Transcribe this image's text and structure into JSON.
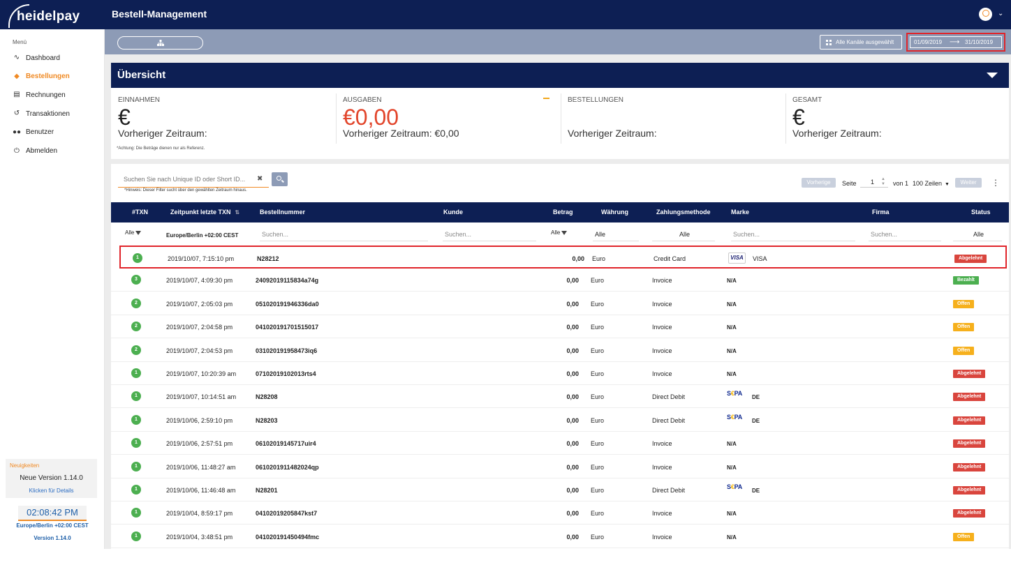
{
  "header": {
    "logo_text": "heidelpay",
    "title": "Bestell-Management"
  },
  "sidebar": {
    "menu_label": "Menü",
    "items": [
      {
        "label": "Dashboard",
        "icon": "chart-line-icon",
        "active": false
      },
      {
        "label": "Bestellungen",
        "icon": "tags-icon",
        "active": true
      },
      {
        "label": "Rechnungen",
        "icon": "document-icon",
        "active": false
      },
      {
        "label": "Transaktionen",
        "icon": "history-icon",
        "active": false
      },
      {
        "label": "Benutzer",
        "icon": "users-icon",
        "active": false
      },
      {
        "label": "Abmelden",
        "icon": "power-icon",
        "active": false
      }
    ],
    "news": {
      "title": "Neuigkeiten",
      "version_text": "Neue Version 1.14.0",
      "link": "Klicken für Details"
    },
    "clock": "02:08:42 PM",
    "timezone": "Europe/Berlin +02:00 CEST",
    "version": "Version 1.14.0"
  },
  "filterbar": {
    "channels_label": "Alle Kanäle ausgewählt",
    "date_from": "01/09/2019",
    "date_to": "31/10/2019"
  },
  "overview": {
    "title": "Übersicht",
    "kpis": [
      {
        "label": "EINNAHMEN",
        "value": "€",
        "prev": "Vorheriger Zeitraum:"
      },
      {
        "label": "AUSGABEN",
        "value": "€0,00",
        "prev": "Vorheriger Zeitraum: €0,00"
      },
      {
        "label": "BESTELLUNGEN",
        "value": "",
        "prev": "Vorheriger Zeitraum:"
      },
      {
        "label": "GESAMT",
        "value": "€",
        "prev": "Vorheriger Zeitraum:"
      }
    ],
    "note": "*Achtung: Die Beträge dienen nur als Referenz."
  },
  "table_controls": {
    "search_placeholder": "Suchen Sie nach Unique ID oder Short ID...",
    "search_hint": "*Hinweis: Dieser Filter sucht über den gewählten Zeitraum hinaus.",
    "prev_label": "Vorherige",
    "page_label": "Seite",
    "page_value": "1",
    "of_label": "von 1",
    "rows_label": "100 Zeilen",
    "next_label": "Weiter"
  },
  "table": {
    "columns": [
      "#TXN",
      "Zeitpunkt letzte TXN",
      "Bestellnummer",
      "Kunde",
      "Betrag",
      "Währung",
      "Zahlungsmethode",
      "Marke",
      "Firma",
      "Status"
    ],
    "filters": {
      "txn": "Alle",
      "timezone": "Europe/Berlin +02:00 CEST",
      "search": "Suchen...",
      "betrag": "Alle",
      "waehrung": "Alle",
      "zahlungsmethode": "Alle",
      "status": "Alle"
    },
    "rows": [
      {
        "txn": "1",
        "time": "2019/10/07, 7:15:10 pm",
        "order": "N28212",
        "amount": "0,00",
        "currency": "Euro",
        "method": "Credit Card",
        "brand_logo": "visa",
        "brand": "VISA",
        "status": "Abgelehnt",
        "status_color": "red"
      },
      {
        "txn": "3",
        "time": "2019/10/07, 4:09:30 pm",
        "order": "24092019115834a74g",
        "amount": "0,00",
        "currency": "Euro",
        "method": "Invoice",
        "brand_logo": "",
        "brand": "N/A",
        "status": "Bezahlt",
        "status_color": "green"
      },
      {
        "txn": "2",
        "time": "2019/10/07, 2:05:03 pm",
        "order": "051020191946336da0",
        "amount": "0,00",
        "currency": "Euro",
        "method": "Invoice",
        "brand_logo": "",
        "brand": "N/A",
        "status": "Offen",
        "status_color": "orange"
      },
      {
        "txn": "2",
        "time": "2019/10/07, 2:04:58 pm",
        "order": "041020191701515017",
        "amount": "0,00",
        "currency": "Euro",
        "method": "Invoice",
        "brand_logo": "",
        "brand": "N/A",
        "status": "Offen",
        "status_color": "orange"
      },
      {
        "txn": "2",
        "time": "2019/10/07, 2:04:53 pm",
        "order": "031020191958473iq6",
        "amount": "0,00",
        "currency": "Euro",
        "method": "Invoice",
        "brand_logo": "",
        "brand": "N/A",
        "status": "Offen",
        "status_color": "orange"
      },
      {
        "txn": "1",
        "time": "2019/10/07, 10:20:39 am",
        "order": "07102019102013rts4",
        "amount": "0,00",
        "currency": "Euro",
        "method": "Invoice",
        "brand_logo": "",
        "brand": "N/A",
        "status": "Abgelehnt",
        "status_color": "red"
      },
      {
        "txn": "1",
        "time": "2019/10/07, 10:14:51 am",
        "order": "N28208",
        "amount": "0,00",
        "currency": "Euro",
        "method": "Direct Debit",
        "brand_logo": "sepa",
        "brand": "DE",
        "status": "Abgelehnt",
        "status_color": "red"
      },
      {
        "txn": "1",
        "time": "2019/10/06, 2:59:10 pm",
        "order": "N28203",
        "amount": "0,00",
        "currency": "Euro",
        "method": "Direct Debit",
        "brand_logo": "sepa",
        "brand": "DE",
        "status": "Abgelehnt",
        "status_color": "red"
      },
      {
        "txn": "1",
        "time": "2019/10/06, 2:57:51 pm",
        "order": "06102019145717uir4",
        "amount": "0,00",
        "currency": "Euro",
        "method": "Invoice",
        "brand_logo": "",
        "brand": "N/A",
        "status": "Abgelehnt",
        "status_color": "red"
      },
      {
        "txn": "1",
        "time": "2019/10/06, 11:48:27 am",
        "order": "0610201911482024qp",
        "amount": "0,00",
        "currency": "Euro",
        "method": "Invoice",
        "brand_logo": "",
        "brand": "N/A",
        "status": "Abgelehnt",
        "status_color": "red"
      },
      {
        "txn": "1",
        "time": "2019/10/06, 11:46:48 am",
        "order": "N28201",
        "amount": "0,00",
        "currency": "Euro",
        "method": "Direct Debit",
        "brand_logo": "sepa",
        "brand": "DE",
        "status": "Abgelehnt",
        "status_color": "red"
      },
      {
        "txn": "1",
        "time": "2019/10/04, 8:59:17 pm",
        "order": "04102019205847kst7",
        "amount": "0,00",
        "currency": "Euro",
        "method": "Invoice",
        "brand_logo": "",
        "brand": "N/A",
        "status": "Abgelehnt",
        "status_color": "red"
      },
      {
        "txn": "1",
        "time": "2019/10/04, 3:48:51 pm",
        "order": "041020191450494fmc",
        "amount": "0,00",
        "currency": "Euro",
        "method": "Invoice",
        "brand_logo": "",
        "brand": "N/A",
        "status": "Offen",
        "status_color": "orange"
      }
    ]
  },
  "colors": {
    "navy": "#0d1f54",
    "accent_orange": "#f08a24",
    "status_red": "#d9453d",
    "status_green": "#4caf50",
    "status_orange": "#f6b01c",
    "highlight_red": "#e0242a"
  }
}
